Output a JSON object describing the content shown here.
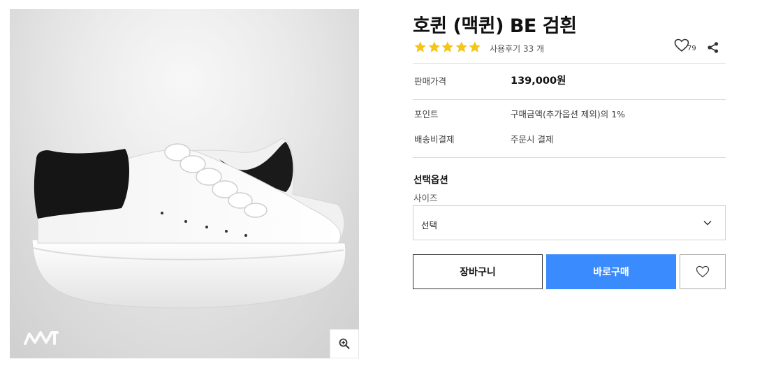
{
  "product": {
    "title": "호퀸 (맥퀸) BE 검흰",
    "image_alt": "white leather sneaker with black heel tab"
  },
  "rating": {
    "stars": 5,
    "max": 5,
    "review_text": "사용후기 33 개",
    "star_color": "#f5c518"
  },
  "wishlist": {
    "count": "79"
  },
  "details": {
    "price_label": "판매가격",
    "price_value": "139,000원",
    "points_label": "포인트",
    "points_value": "구매금액(추가옵션 제외)의 1%",
    "shipping_label": "배송비결제",
    "shipping_value": "주문시 결제"
  },
  "options": {
    "title": "선택옵션",
    "size_label": "사이즈",
    "size_selected": "선택"
  },
  "actions": {
    "cart_label": "장바구니",
    "buy_label": "바로구매"
  },
  "colors": {
    "accent": "#3a8bfd",
    "divider": "#dcdcdc"
  },
  "icons": [
    "zoom-in-icon",
    "heart-icon",
    "share-icon",
    "chevron-down-icon",
    "star-icon"
  ]
}
